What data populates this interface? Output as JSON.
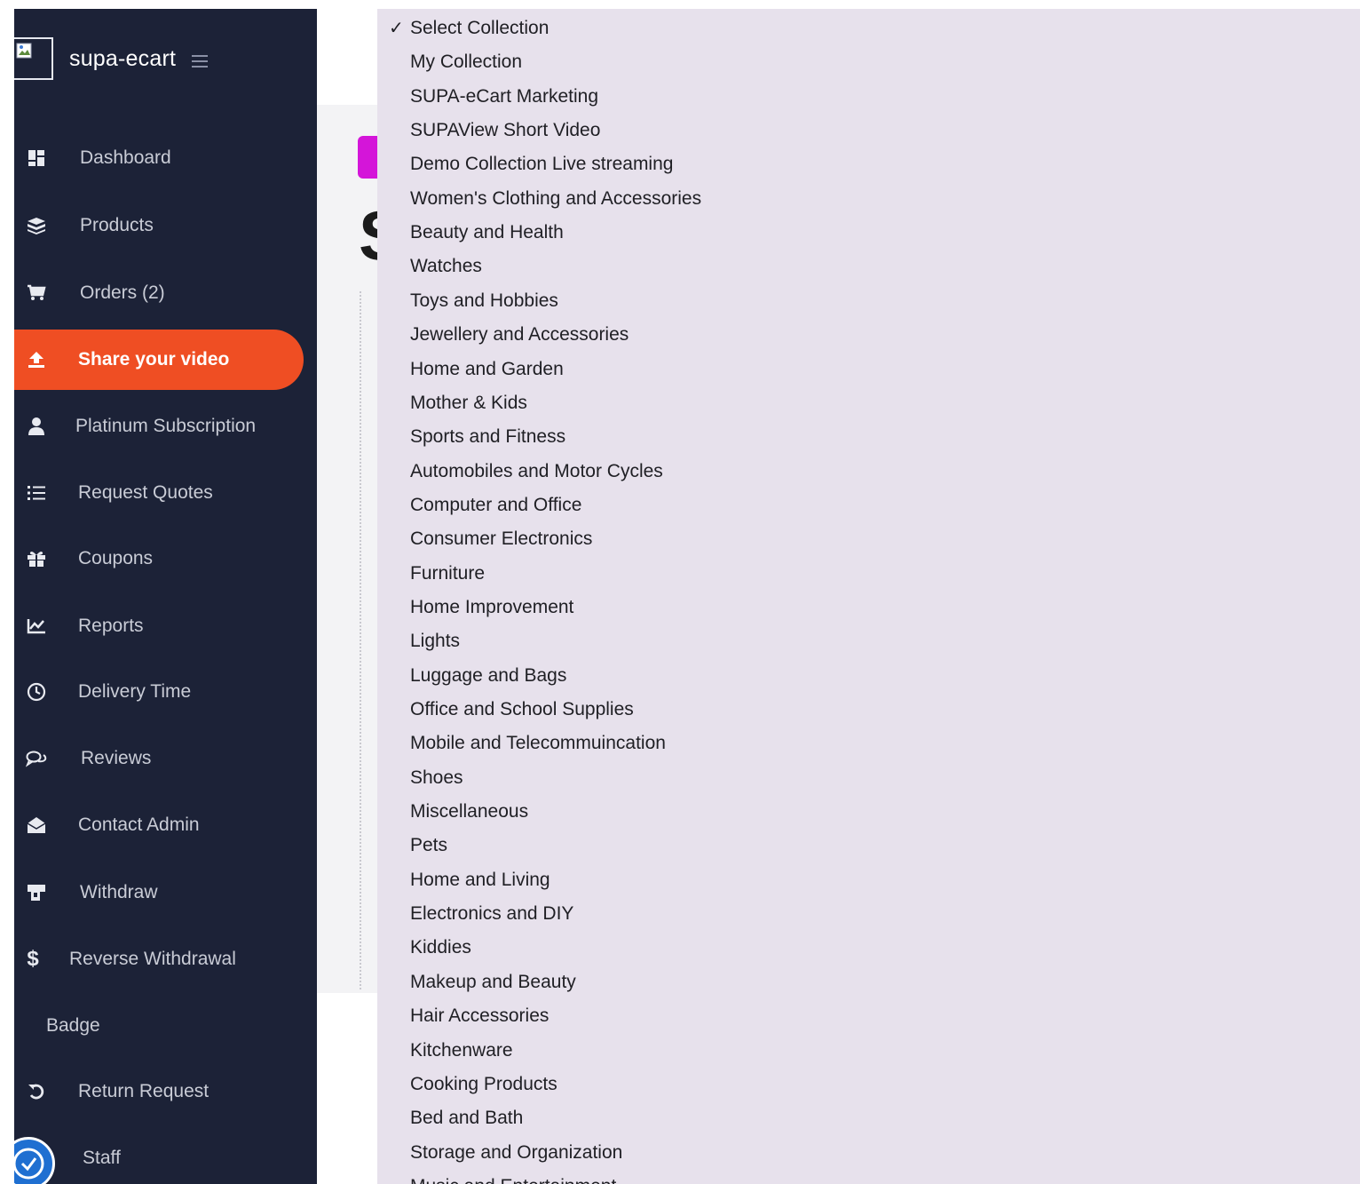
{
  "brand": {
    "name": "supa-ecart"
  },
  "sidebar": {
    "items": [
      {
        "label": "Dashboard",
        "icon": "dashboard-icon"
      },
      {
        "label": "Products",
        "icon": "cube-icon"
      },
      {
        "label": "Orders (2)",
        "icon": "cart-icon"
      },
      {
        "label": "Share your video",
        "icon": "upload-icon",
        "active": true
      },
      {
        "label": "Platinum Subscription",
        "icon": "user-icon"
      },
      {
        "label": "Request Quotes",
        "icon": "list-icon"
      },
      {
        "label": "Coupons",
        "icon": "gift-icon"
      },
      {
        "label": "Reports",
        "icon": "chart-icon"
      },
      {
        "label": "Delivery Time",
        "icon": "clock-icon"
      },
      {
        "label": "Reviews",
        "icon": "comments-icon"
      },
      {
        "label": "Contact Admin",
        "icon": "envelope-open-icon"
      },
      {
        "label": "Withdraw",
        "icon": "withdraw-icon"
      },
      {
        "label": "Reverse Withdrawal",
        "icon": "dollar-icon"
      },
      {
        "label": "Badge",
        "icon": ""
      },
      {
        "label": "Return Request",
        "icon": "undo-icon"
      },
      {
        "label": "Staff",
        "icon": ""
      }
    ]
  },
  "main": {
    "partial_heading_glyph": "S"
  },
  "collection_dropdown": {
    "check_mark": "✓",
    "selected": "Select Collection",
    "options": [
      "Select Collection",
      "My Collection",
      "SUPA-eCart Marketing",
      "SUPAView Short Video",
      "Demo Collection Live streaming",
      "Women's Clothing and Accessories",
      "Beauty and Health",
      "Watches",
      "Toys and Hobbies",
      "Jewellery and Accessories",
      "Home and Garden",
      "Mother & Kids",
      "Sports and Fitness",
      "Automobiles and Motor Cycles",
      "Computer and Office",
      "Consumer Electronics",
      "Furniture",
      "Home Improvement",
      "Lights",
      "Luggage and Bags",
      "Office and School Supplies",
      "Mobile and Telecommuincation",
      "Shoes",
      "Miscellaneous",
      "Pets",
      "Home and Living",
      "Electronics and DIY",
      "Kiddies",
      "Makeup and Beauty",
      "Hair Accessories",
      "Kitchenware",
      "Cooking Products",
      "Bed and Bath",
      "Storage and Organization",
      "Music and Entertainment"
    ]
  },
  "colors": {
    "sidebar_bg": "#1c2237",
    "active_item": "#ef4e23",
    "dropdown_bg": "#e7e1ec",
    "accent_tab": "#d415d9"
  }
}
